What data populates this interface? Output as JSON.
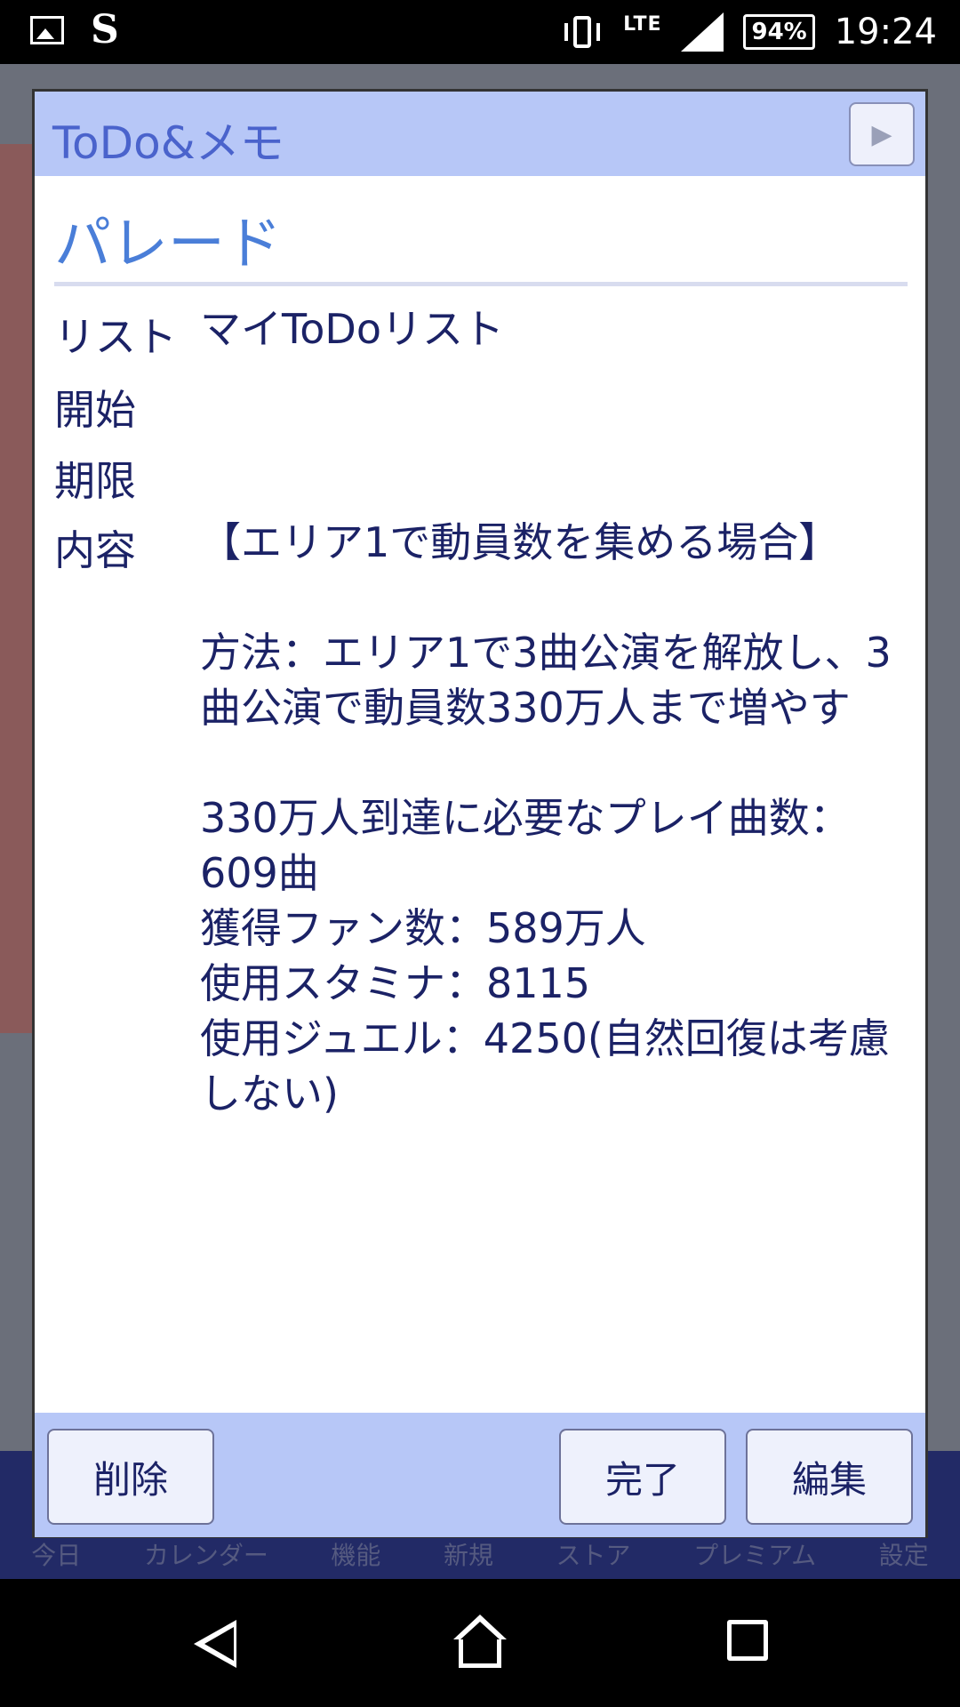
{
  "status_bar": {
    "network": "LTE",
    "battery": "94%",
    "time": "19:24",
    "icons": [
      "gallery-icon",
      "s-app-icon",
      "vibrate-icon",
      "signal-icon",
      "battery-icon"
    ]
  },
  "background_app": {
    "tabs": [
      "今日",
      "カレンダー",
      "機能",
      "新規",
      "ストア",
      "プレミアム",
      "設定"
    ]
  },
  "dialog": {
    "header_title": "ToDo&メモ",
    "next_icon": "▶",
    "item_title": "パレード",
    "fields": {
      "list_label": "リスト",
      "list_value": "マイToDoリスト",
      "start_label": "開始",
      "start_value": "",
      "due_label": "期限",
      "due_value": "",
      "content_label": "内容",
      "content_value": "【エリア1で動員数を集める場合】\n\n方法：エリア1で3曲公演を解放し、3曲公演で動員数330万人まで増やす\n\n330万人到達に必要なプレイ曲数：609曲\n獲得ファン数：589万人\n使用スタミナ：8115\n使用ジュエル：4250(自然回復は考慮しない)"
    },
    "buttons": {
      "delete": "削除",
      "complete": "完了",
      "edit": "編集"
    }
  },
  "colors": {
    "header_bg": "#b7c7f7",
    "header_text": "#4a63cc",
    "title_text": "#4a7ed8",
    "body_text": "#1b2266"
  }
}
